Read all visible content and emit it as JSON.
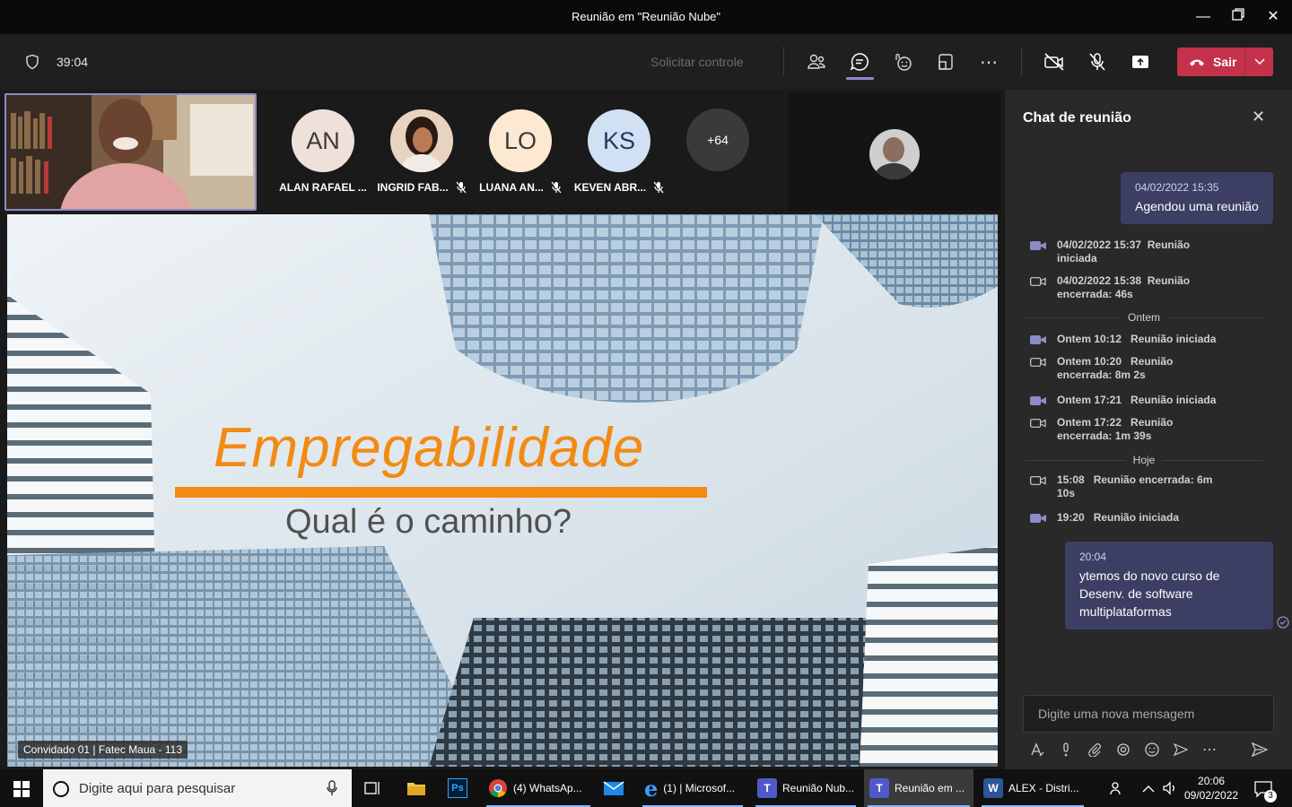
{
  "window": {
    "title": "Reunião em \"Reunião Nube\""
  },
  "toolbar": {
    "timer": "39:04",
    "request_control": "Solicitar controle",
    "leave_label": "Sair"
  },
  "participants": [
    {
      "initials": "AN",
      "name": "ALAN RAFAEL ...",
      "color": "#efe0da",
      "text": "#3b3b3b",
      "muted": false
    },
    {
      "initials": "",
      "name": "INGRID FAB...",
      "color": "#d9b8a0",
      "text": "#3b3b3b",
      "muted": true
    },
    {
      "initials": "LO",
      "name": "LUANA AN...",
      "color": "#fde8d2",
      "text": "#3b3b3b",
      "muted": true
    },
    {
      "initials": "KS",
      "name": "KEVEN ABR...",
      "color": "#d2e0f3",
      "text": "#1f3a5f",
      "muted": true
    }
  ],
  "more_participants": "+64",
  "slide": {
    "title": "Empregabilidade",
    "subtitle": "Qual é o caminho?",
    "name_tag": "Convidado 01 | Fatec Maua - 113"
  },
  "chat": {
    "title": "Chat de reunião",
    "first_bubble": {
      "time": "04/02/2022 15:35",
      "text": "Agendou uma reunião"
    },
    "events": [
      {
        "type": "start",
        "line1": "04/02/2022 15:37  Reunião",
        "line2": "iniciada"
      },
      {
        "type": "end",
        "line1": "04/02/2022 15:38  Reunião",
        "line2": "encerrada: 46s"
      },
      {
        "type": "start",
        "line1": "Ontem 10:12   Reunião iniciada",
        "line2": ""
      },
      {
        "type": "end",
        "line1": "Ontem 10:20   Reunião",
        "line2": "encerrada: 8m 2s"
      },
      {
        "type": "start",
        "line1": "Ontem 17:21   Reunião iniciada",
        "line2": ""
      },
      {
        "type": "end",
        "line1": "Ontem 17:22   Reunião",
        "line2": "encerrada: 1m 39s"
      },
      {
        "type": "end",
        "line1": "15:08   Reunião encerrada: 6m",
        "line2": "10s"
      },
      {
        "type": "start",
        "line1": "19:20   Reunião iniciada",
        "line2": ""
      }
    ],
    "dividers": [
      "Ontem",
      "Hoje"
    ],
    "last_bubble": {
      "time": "20:04",
      "text": "ytemos do novo curso de Desenv. de software multiplataformas"
    },
    "compose_placeholder": "Digite uma nova mensagem"
  },
  "taskbar": {
    "search_placeholder": "Digite aqui para pesquisar",
    "apps": [
      {
        "label": "(4) WhatsAp...",
        "icon": "chrome-icon"
      },
      {
        "label": "(1) | Microsof...",
        "icon": "edge-icon"
      },
      {
        "label": "Reunião Nub...",
        "icon": "teams-icon"
      },
      {
        "label": "Reunião em ...",
        "icon": "teams-icon"
      },
      {
        "label": "ALEX - Distri...",
        "icon": "word-icon"
      }
    ],
    "time": "20:06",
    "date": "09/02/2022",
    "notifications": "3"
  }
}
